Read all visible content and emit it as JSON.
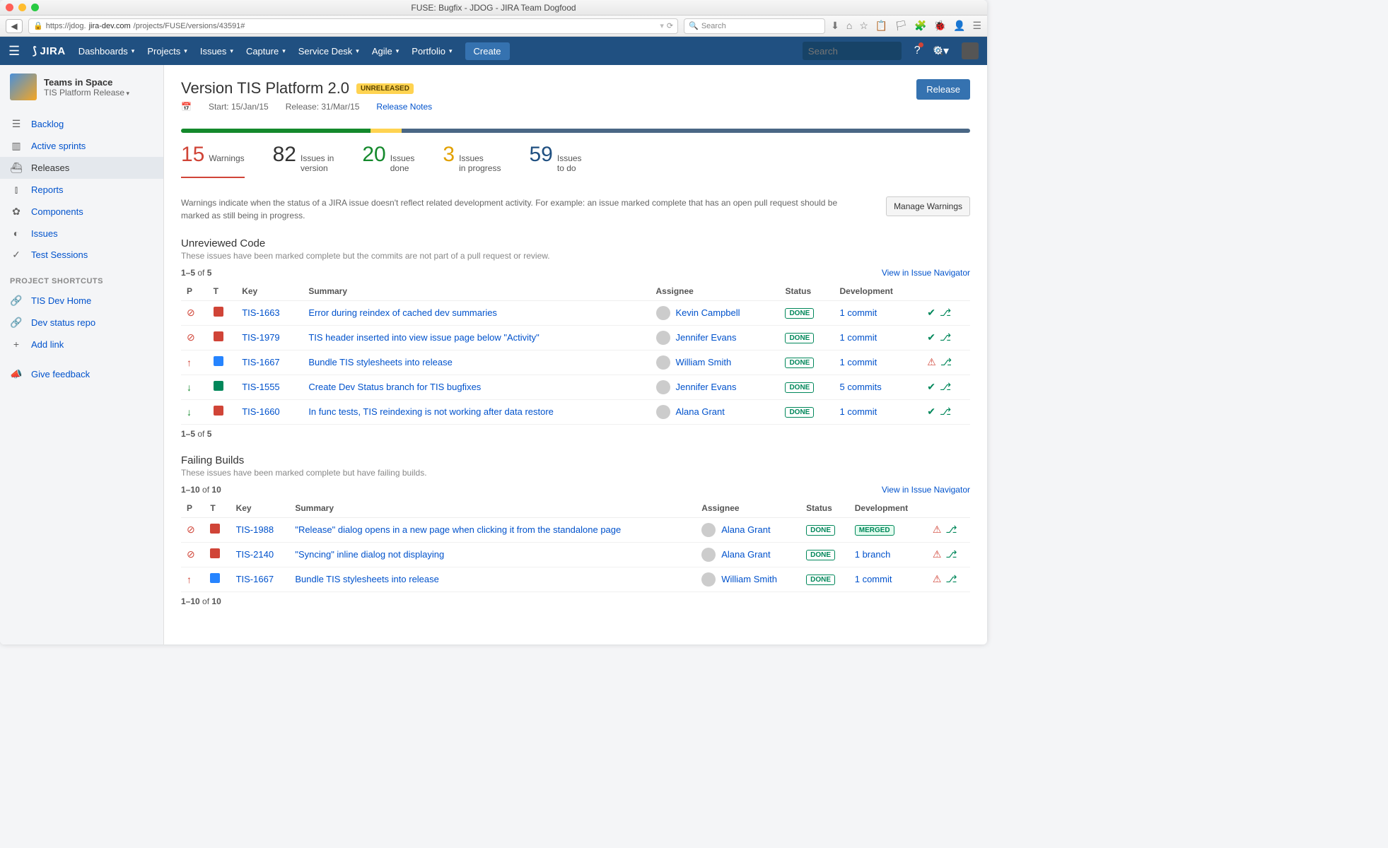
{
  "window": {
    "title": "FUSE: Bugfix - JDOG - JIRA Team Dogfood"
  },
  "browser": {
    "url_prefix": "https://jdog.",
    "url_domain": "jira-dev.com",
    "url_path": "/projects/FUSE/versions/43591#",
    "search_placeholder": "Search"
  },
  "nav": {
    "items": [
      "Dashboards",
      "Projects",
      "Issues",
      "Capture",
      "Service Desk",
      "Agile",
      "Portfolio"
    ],
    "create": "Create",
    "search_placeholder": "Search"
  },
  "sidebar": {
    "project": {
      "name": "Teams in Space",
      "release": "TIS Platform Release"
    },
    "items": [
      {
        "icon": "☰",
        "label": "Backlog"
      },
      {
        "icon": "▥",
        "label": "Active sprints"
      },
      {
        "icon": "⛴",
        "label": "Releases",
        "active": true
      },
      {
        "icon": "⫾",
        "label": "Reports"
      },
      {
        "icon": "✿",
        "label": "Components"
      },
      {
        "icon": "◐",
        "label": "Issues"
      },
      {
        "icon": "✓",
        "label": "Test Sessions"
      }
    ],
    "shortcuts_header": "PROJECT SHORTCUTS",
    "shortcuts": [
      {
        "icon": "🔗",
        "label": "TIS Dev Home"
      },
      {
        "icon": "🔗",
        "label": "Dev status repo"
      },
      {
        "icon": "+",
        "label": "Add link"
      }
    ],
    "feedback": {
      "icon": "📣",
      "label": "Give feedback"
    }
  },
  "main": {
    "title": "Version TIS Platform 2.0",
    "badge": "UNRELEASED",
    "release_btn": "Release",
    "meta": {
      "start": "Start: 15/Jan/15",
      "release": "Release: 31/Mar/15",
      "notes": "Release Notes"
    },
    "progress": {
      "green": 24,
      "yellow": 4,
      "blue": 72
    },
    "stats": [
      {
        "num": "15",
        "label": "Warnings",
        "color": "c-red",
        "active": true
      },
      {
        "num": "82",
        "label": "Issues in\nversion",
        "color": "c-dark"
      },
      {
        "num": "20",
        "label": "Issues\ndone",
        "color": "c-green"
      },
      {
        "num": "3",
        "label": "Issues\nin progress",
        "color": "c-yellow"
      },
      {
        "num": "59",
        "label": "Issues\nto do",
        "color": "c-blue"
      }
    ],
    "warning_text": "Warnings indicate when the status of a JIRA issue doesn't reflect related development activity. For example: an issue marked complete that has an open pull request should be marked as still being in progress.",
    "manage_btn": "Manage Warnings",
    "view_navigator": "View in Issue Navigator",
    "headers": [
      "P",
      "T",
      "Key",
      "Summary",
      "Assignee",
      "Status",
      "Development"
    ],
    "section1": {
      "title": "Unreviewed Code",
      "subtitle": "These issues have been marked complete but the commits are not part of a pull request or review.",
      "pager": "1–5 of 5",
      "rows": [
        {
          "p": "⊘",
          "pc": "c-red",
          "t": "ti-red",
          "key": "TIS-1663",
          "summary": "Error during reindex of cached dev summaries",
          "assignee": "Kevin Campbell",
          "status": "DONE",
          "dev": "1 commit",
          "di": [
            "ok",
            "branch"
          ]
        },
        {
          "p": "⊘",
          "pc": "c-red",
          "t": "ti-red",
          "key": "TIS-1979",
          "summary": "TIS header inserted into view issue page below \"Activity\"",
          "assignee": "Jennifer Evans",
          "status": "DONE",
          "dev": "1 commit",
          "di": [
            "ok",
            "branch"
          ]
        },
        {
          "p": "↑",
          "pc": "c-red",
          "t": "ti-blue",
          "key": "TIS-1667",
          "summary": "Bundle TIS stylesheets into release",
          "assignee": "William Smith",
          "status": "DONE",
          "dev": "1 commit",
          "di": [
            "warn",
            "branch"
          ]
        },
        {
          "p": "↓",
          "pc": "c-green",
          "t": "ti-green",
          "key": "TIS-1555",
          "summary": "Create Dev Status branch for TIS bugfixes",
          "assignee": "Jennifer Evans",
          "status": "DONE",
          "dev": "5 commits",
          "di": [
            "ok",
            "branch"
          ]
        },
        {
          "p": "↓",
          "pc": "c-green",
          "t": "ti-red",
          "key": "TIS-1660",
          "summary": "In func tests, TIS reindexing is not working after data restore",
          "assignee": "Alana Grant",
          "status": "DONE",
          "dev": "1 commit",
          "di": [
            "ok",
            "branch"
          ]
        }
      ]
    },
    "section2": {
      "title": "Failing Builds",
      "subtitle": "These issues have been marked complete but have failing builds.",
      "pager": "1–10 of 10",
      "rows": [
        {
          "p": "⊘",
          "pc": "c-red",
          "t": "ti-red",
          "key": "TIS-1988",
          "summary": "\"Release\" dialog opens in a new page when clicking it from the standalone page",
          "assignee": "Alana Grant",
          "status": "DONE",
          "dev": "MERGED",
          "merged": true,
          "di": [
            "warn",
            "branch"
          ]
        },
        {
          "p": "⊘",
          "pc": "c-red",
          "t": "ti-red",
          "key": "TIS-2140",
          "summary": "\"Syncing\" inline dialog not displaying",
          "assignee": "Alana Grant",
          "status": "DONE",
          "dev": "1 branch",
          "di": [
            "warn",
            "branch"
          ]
        },
        {
          "p": "↑",
          "pc": "c-red",
          "t": "ti-blue",
          "key": "TIS-1667",
          "summary": "Bundle TIS stylesheets into release",
          "assignee": "William Smith",
          "status": "DONE",
          "dev": "1 commit",
          "di": [
            "warn",
            "branch"
          ]
        }
      ]
    }
  }
}
